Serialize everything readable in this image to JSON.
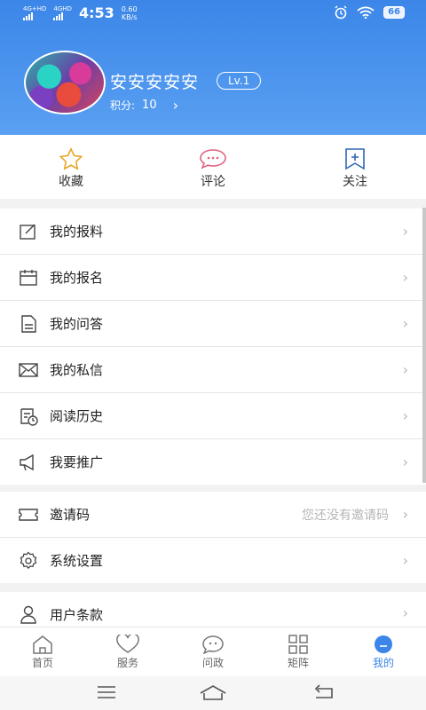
{
  "status": {
    "net1": "4G+HD",
    "net2": "4GHD",
    "time": "4:53",
    "speed_value": "0.60",
    "speed_unit": "KB/s",
    "battery": "66"
  },
  "profile": {
    "username": "安安安安安",
    "level": "Lv.1",
    "points_label": "积分:",
    "points_value": "10"
  },
  "quick_actions": [
    {
      "label": "收藏",
      "icon": "star-icon"
    },
    {
      "label": "评论",
      "icon": "comment-icon"
    },
    {
      "label": "关注",
      "icon": "follow-icon"
    }
  ],
  "menu_group1": [
    {
      "label": "我的报料",
      "icon": "edit-icon"
    },
    {
      "label": "我的报名",
      "icon": "calendar-icon"
    },
    {
      "label": "我的问答",
      "icon": "document-icon"
    },
    {
      "label": "我的私信",
      "icon": "mail-icon"
    },
    {
      "label": "阅读历史",
      "icon": "history-icon"
    },
    {
      "label": "我要推广",
      "icon": "megaphone-icon"
    }
  ],
  "menu_group2": [
    {
      "label": "邀请码",
      "icon": "ticket-icon",
      "hint": "您还没有邀请码"
    },
    {
      "label": "系统设置",
      "icon": "settings-icon"
    }
  ],
  "menu_group3": [
    {
      "label": "用户条款",
      "icon": "user-icon"
    }
  ],
  "tabs": [
    {
      "label": "首页",
      "icon": "home-icon"
    },
    {
      "label": "服务",
      "icon": "heart-icon"
    },
    {
      "label": "问政",
      "icon": "chat-icon"
    },
    {
      "label": "矩阵",
      "icon": "grid-icon"
    },
    {
      "label": "我的",
      "icon": "profile-icon",
      "active": true
    }
  ],
  "colors": {
    "accent": "#3b86e8"
  }
}
